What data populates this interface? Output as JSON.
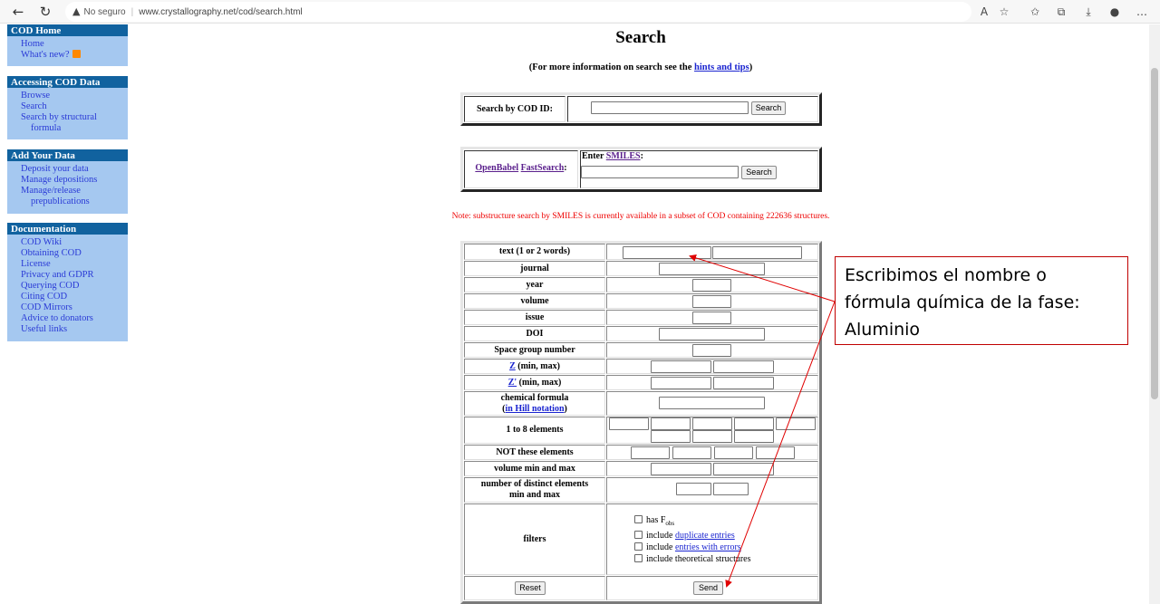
{
  "browser": {
    "security_label": "No seguro",
    "url": "www.crystallography.net/cod/search.html",
    "icons": [
      "back-icon",
      "refresh-icon",
      "read-aloud-icon",
      "add-favorite-icon",
      "favorites-icon",
      "collections-icon",
      "downloads-icon",
      "profile-icon",
      "more-icon"
    ]
  },
  "sidebar": {
    "sections": [
      {
        "title": "COD Home",
        "items": [
          "Home",
          "What's new?"
        ]
      },
      {
        "title": "Accessing COD Data",
        "items": [
          "Browse",
          "Search",
          "Search by structural",
          "formula"
        ]
      },
      {
        "title": "Add Your Data",
        "items": [
          "Deposit your data",
          "Manage depositions",
          "Manage/release",
          "prepublications"
        ]
      },
      {
        "title": "Documentation",
        "items": [
          "COD Wiki",
          "Obtaining COD",
          "License",
          "Privacy and GDPR",
          "Querying COD",
          "Citing COD",
          "COD Mirrors",
          "Advice to donators",
          "Useful links"
        ]
      }
    ]
  },
  "page": {
    "title": "Search",
    "subtitle_pre": "(For more information on search see the ",
    "subtitle_link": "hints and tips",
    "subtitle_post": ")",
    "codid_label": "Search by COD ID:",
    "search_button": "Search",
    "openbabel": "OpenBabel",
    "fastsearch": "FastSearch",
    "colon": ":",
    "smiles_pre": "Enter ",
    "smiles_link": "SMILES",
    "smiles_post": ":",
    "note": "Note: substructure search by SMILES is currently available in a subset of COD containing 222636 structures."
  },
  "form": {
    "text": "text (1 or 2 words)",
    "journal": "journal",
    "year": "year",
    "volume": "volume",
    "issue": "issue",
    "doi": "DOI",
    "spacegroup": "Space group number",
    "z_link": "Z",
    "z_rest": " (min, max)",
    "zp_link": "Z'",
    "zp_rest": " (min, max)",
    "chem1": "chemical formula",
    "chem_open": "(",
    "chem_link": "in Hill notation",
    "chem_close": ")",
    "elements": "1 to 8 elements",
    "not_elements": "NOT these elements",
    "volume_minmax": "volume min and max",
    "distinct1": "number of distinct elements",
    "distinct2": "min and max",
    "filters": "filters",
    "f_has": "has F",
    "f_has_sub": "obs",
    "f_dup_pre": "include ",
    "f_dup_link": "duplicate entries",
    "f_err_pre": "include ",
    "f_err_link": "entries with errors",
    "f_theo": "include theoretical structures",
    "reset": "Reset",
    "send": "Send"
  },
  "annotation": {
    "text": "Escribimos el nombre o fórmula química de la fase: Aluminio",
    "color": "#c00000"
  }
}
